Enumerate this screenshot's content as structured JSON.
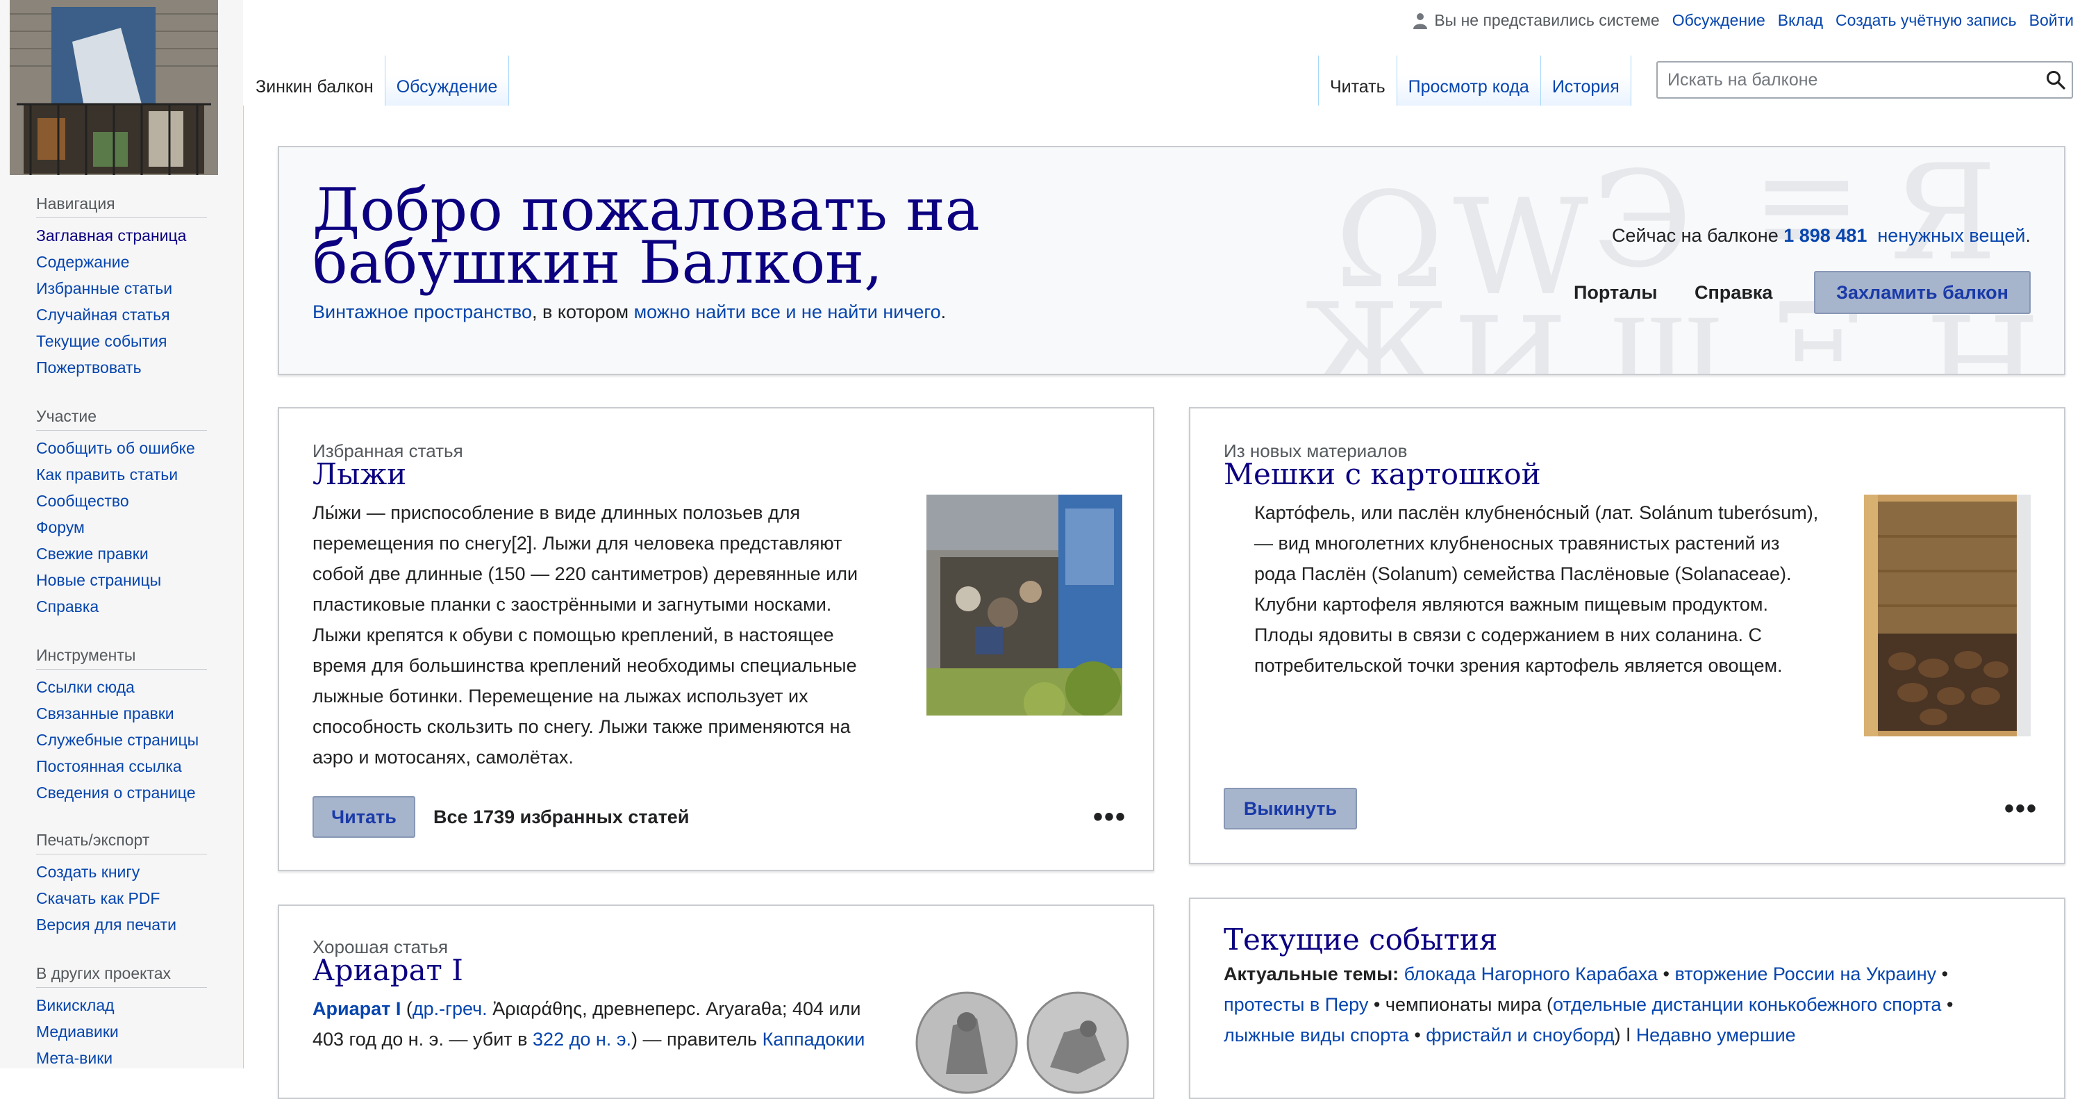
{
  "personal": {
    "not_logged": "Вы не представились системе",
    "links": [
      "Обсуждение",
      "Вклад",
      "Создать учётную запись",
      "Войти"
    ]
  },
  "tabs_left": [
    {
      "label": "Зинкин балкон",
      "selected": true
    },
    {
      "label": "Обсуждение",
      "selected": false
    }
  ],
  "tabs_right": [
    {
      "label": "Читать",
      "selected": true
    },
    {
      "label": "Просмотр кода",
      "selected": false
    },
    {
      "label": "История",
      "selected": false
    }
  ],
  "search": {
    "placeholder": "Искать на балконе",
    "icon": "search-icon"
  },
  "sidebar": {
    "sections": [
      {
        "heading": "Навигация",
        "items": [
          "Заглавная страница",
          "Содержание",
          "Избранные статьи",
          "Случайная статья",
          "Текущие события",
          "Пожертвовать"
        ]
      },
      {
        "heading": "Участие",
        "items": [
          "Сообщить об ошибке",
          "Как править статьи",
          "Сообщество",
          "Форум",
          "Свежие правки",
          "Новые страницы",
          "Справка"
        ]
      },
      {
        "heading": "Инструменты",
        "items": [
          "Ссылки сюда",
          "Связанные правки",
          "Служебные страницы",
          "Постоянная ссылка",
          "Сведения о странице"
        ]
      },
      {
        "heading": "Печать/экспорт",
        "items": [
          "Создать книгу",
          "Скачать как PDF",
          "Версия для печати"
        ]
      },
      {
        "heading": "В других проектах",
        "items": [
          "Викисклад",
          "Медиавики",
          "Мета-вики"
        ]
      }
    ]
  },
  "welcome": {
    "title_line1": "Добро пожаловать на",
    "title_line2": "бабушкин Балкон,",
    "sub_link1": "Винтажное пространство",
    "sub_mid": ",  в котором",
    "sub_link2": "можно найти все и не найти ничего",
    "sub_end": ".",
    "count_prefix": "Сейчас на балконе",
    "count": "1 898 481",
    "count_suffix": "ненужных вещей",
    "count_end": ".",
    "btn_portals": "Порталы",
    "btn_help": "Справка",
    "btn_clutter": "Захламить балкон"
  },
  "featured": {
    "label": "Избранная статья",
    "title": "Лыжи",
    "lines": [
      "Лы́жи — приспособление в виде длинных полозьев для",
      "перемещения по снегу[2]. Лыжи для человека представляют",
      "собой две длинные (150 — 220 сантиметров) деревянные или",
      "пластиковые планки с заострёнными и загнутыми носками.",
      "Лыжи крепятся к обуви с помощью креплений, в настоящее",
      "время для большинства креплений необходимы специальные",
      "лыжные ботинки. Перемещение на лыжах использует их",
      "способность скользить по снегу. Лыжи также применяются на",
      "аэро и мотосанях, самолётах."
    ],
    "read_btn": "Читать",
    "all_link": "Все 1739 избранных статей",
    "more": "•••"
  },
  "new_material": {
    "label": "Из новых материалов",
    "title": "Мешки с картошкой",
    "lines": [
      "Карто́фель, или паслён клубнено́сный (лат. Solánum tuberósum),",
      "— вид многолетних клубненосных травянистых растений из",
      "рода Паслён (Solanum) семейства Паслёновые (Solanaceae).",
      "Клубни картофеля являются важным пищевым продуктом.",
      "Плоды ядовиты в связи с содержанием в них соланина. С",
      "потребительской точки зрения картофель является овощем."
    ],
    "btn": "Выкинуть",
    "more": "•••"
  },
  "good_article": {
    "label": "Хорошая статья",
    "title": "Ариарат I",
    "line1_bold": "Ариарат I",
    "line1_link": "др.-греч.",
    "line1_rest": "Ἀριαράθης, древнеперс. Aryaraθa; 404 или",
    "line2_pre": "403 год до н. э. — убит в",
    "line2_link": "322 до н. э.",
    "line2_mid": ") — правитель",
    "line2_link2": "Каппадокии"
  },
  "current_events": {
    "title": "Текущие события",
    "topics_label": "Актуальные темы:",
    "t1": "блокада Нагорного Карабаха",
    "t2": "вторжение России на Украину",
    "t3": "протесты в Перу",
    "t4": "чемпионаты мира (",
    "t5": "отдельные дистанции конькобежного спорта",
    "t6": "лыжные виды спорта",
    "t7": "фристайл и сноуборд",
    "t8": ") ǀ",
    "t9": "Недавно умершие",
    "sep": "•"
  }
}
